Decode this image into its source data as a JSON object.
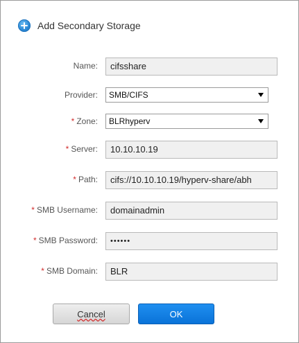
{
  "dialog": {
    "title": "Add Secondary Storage",
    "icon": "plus-circle-icon",
    "accent_color": "#1f8ff0",
    "required_color": "#d12c2c"
  },
  "form": {
    "name": {
      "label": "Name:",
      "value": "cifsshare",
      "required": false
    },
    "provider": {
      "label": "Provider:",
      "value": "SMB/CIFS",
      "required": false
    },
    "zone": {
      "label": "Zone:",
      "value": "BLRhyperv",
      "required": true
    },
    "server": {
      "label": "Server:",
      "value": "10.10.10.19",
      "required": true
    },
    "path": {
      "label": "Path:",
      "value": "cifs://10.10.10.19/hyperv-share/abh",
      "required": true
    },
    "smb_username": {
      "label": "SMB Username:",
      "value": "domainadmin",
      "required": true
    },
    "smb_password": {
      "label": "SMB Password:",
      "value": "••••••",
      "required": true
    },
    "smb_domain": {
      "label": "SMB Domain:",
      "value": "BLR",
      "required": true
    },
    "required_mark": "*"
  },
  "buttons": {
    "cancel": "Cancel",
    "ok": "OK"
  }
}
